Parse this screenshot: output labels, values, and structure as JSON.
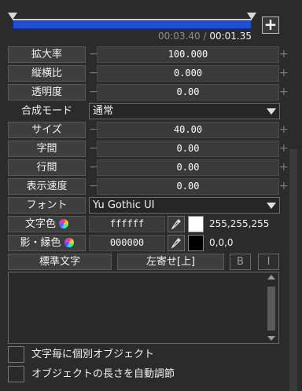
{
  "timeline": {
    "current_time": "00:03.40",
    "separator": " / ",
    "total_time": "00:01.35",
    "add_label": "+"
  },
  "properties": [
    {
      "label": "拡大率",
      "value": "100.000"
    },
    {
      "label": "縦横比",
      "value": "0.000"
    },
    {
      "label": "透明度",
      "value": "0.00"
    },
    {
      "label": "合成モード",
      "select": "通常"
    },
    {
      "label": "サイズ",
      "value": "40.00"
    },
    {
      "label": "字間",
      "value": "0.00"
    },
    {
      "label": "行間",
      "value": "0.00"
    },
    {
      "label": "表示速度",
      "value": "0.00"
    },
    {
      "label": "フォント",
      "select": "Yu Gothic UI"
    }
  ],
  "text_color": {
    "label": "文字色",
    "hex": "ffffff",
    "rgb": "255,255,255",
    "swatch": "#ffffff"
  },
  "shadow_color": {
    "label": "影・縁色",
    "hex": "000000",
    "rgb": "0,0,0",
    "swatch": "#000000"
  },
  "buttons": {
    "standard_text": "標準文字",
    "align": "左寄せ[上]",
    "bold": "B",
    "italic": "I"
  },
  "text_content": "",
  "checkboxes": [
    {
      "label": "文字毎に個別オブジェクト",
      "checked": false
    },
    {
      "label": "オブジェクトの長さを自動調節",
      "checked": false
    }
  ],
  "glyphs": {
    "minus": "−",
    "plus": "+"
  }
}
